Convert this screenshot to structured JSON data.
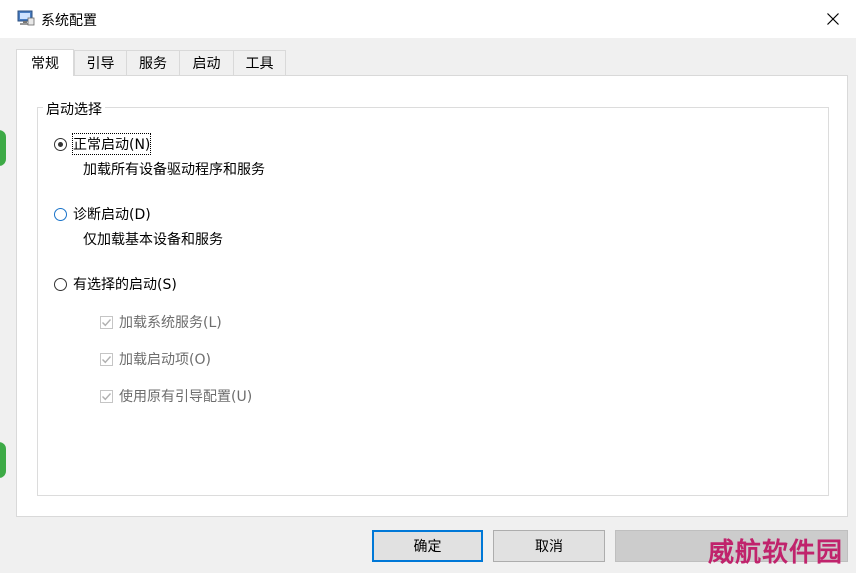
{
  "window": {
    "title": "系统配置",
    "icon": "msconfig-computer-icon"
  },
  "tabs": [
    {
      "label": "常规",
      "active": true
    },
    {
      "label": "引导",
      "active": false
    },
    {
      "label": "服务",
      "active": false
    },
    {
      "label": "启动",
      "active": false
    },
    {
      "label": "工具",
      "active": false
    }
  ],
  "startup_selection": {
    "group_title": "启动选择",
    "normal": {
      "label": "正常启动(N)",
      "desc": "加载所有设备驱动程序和服务",
      "checked": true
    },
    "diagnostic": {
      "label": "诊断启动(D)",
      "desc": "仅加载基本设备和服务",
      "checked": false
    },
    "selective": {
      "label": "有选择的启动(S)",
      "checked": false
    },
    "options": [
      {
        "label": "加载系统服务(L)",
        "checked": true,
        "disabled": true
      },
      {
        "label": "加载启动项(O)",
        "checked": true,
        "disabled": true
      },
      {
        "label": "使用原有引导配置(U)",
        "checked": true,
        "disabled": true
      }
    ]
  },
  "buttons": {
    "ok": "确定",
    "cancel": "取消",
    "apply": ""
  },
  "watermark": "威航软件园",
  "colors": {
    "accent": "#0078d7",
    "watermark": "#c0236c"
  }
}
